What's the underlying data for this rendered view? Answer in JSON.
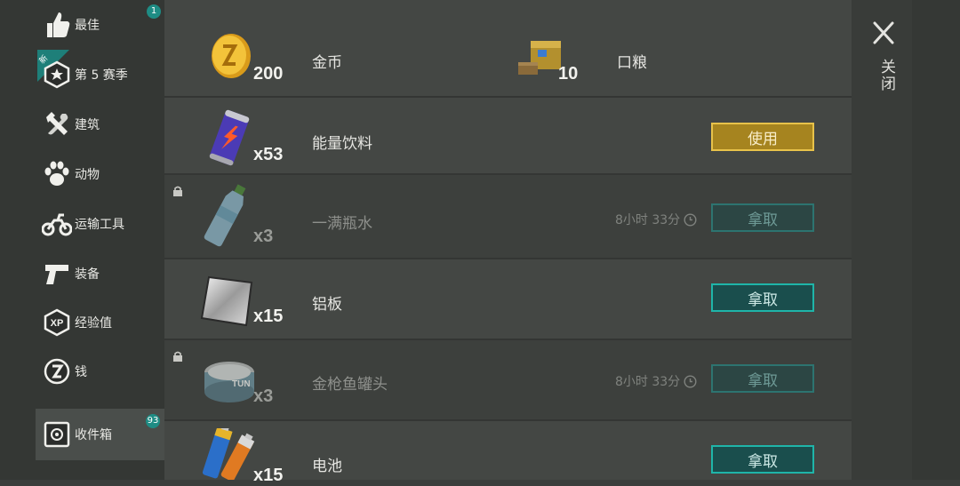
{
  "sidebar": {
    "items": [
      {
        "label": "最佳",
        "icon": "thumbs-up-icon",
        "badge": "1"
      },
      {
        "label": "第 5 赛季",
        "icon": "season-star-icon",
        "flag": "新"
      },
      {
        "label": "建筑",
        "icon": "hammer-wrench-icon"
      },
      {
        "label": "动物",
        "icon": "paw-icon"
      },
      {
        "label": "运输工具",
        "icon": "motorcycle-icon"
      },
      {
        "label": "装备",
        "icon": "pistol-icon"
      },
      {
        "label": "经验值",
        "icon": "xp-icon",
        "icon_text": "XP"
      },
      {
        "label": "钱",
        "icon": "coin-icon"
      },
      {
        "label": "收件箱",
        "icon": "safe-icon",
        "badge": "93"
      }
    ]
  },
  "rewards": {
    "coins": {
      "qty": "200",
      "name": "金币"
    },
    "ration": {
      "qty": "10",
      "name": "口粮"
    }
  },
  "items": [
    {
      "name": "能量饮料",
      "qty": "x53",
      "button": "使用",
      "icon": "energy-drink-icon"
    },
    {
      "name": "一满瓶水",
      "qty": "x3",
      "timer": "8小时 33分",
      "button": "拿取",
      "locked": true,
      "icon": "water-bottle-icon"
    },
    {
      "name": "铝板",
      "qty": "x15",
      "button": "拿取",
      "icon": "aluminum-plate-icon"
    },
    {
      "name": "金枪鱼罐头",
      "qty": "x3",
      "timer": "8小时 33分",
      "button": "拿取",
      "locked": true,
      "icon": "tuna-can-icon",
      "can_text": "TUN"
    },
    {
      "name": "电池",
      "qty": "x15",
      "button": "拿取",
      "icon": "batteries-icon"
    }
  ],
  "close_label": "关闭",
  "colors": {
    "accent": "#1fb5a9",
    "use_button": "#a6841f",
    "badge": "#1e8c84"
  }
}
